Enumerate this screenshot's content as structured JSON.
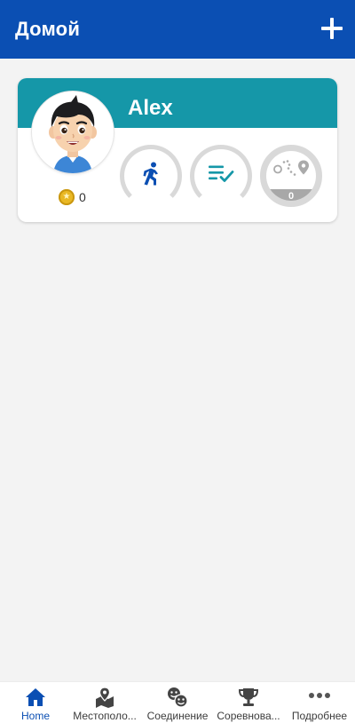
{
  "app_bar": {
    "title": "Домой",
    "add_icon": "plus-icon"
  },
  "profile_card": {
    "name": "Alex",
    "coins": "0",
    "header_color": "#1597a8",
    "status_rings": [
      {
        "id": "steps",
        "icon": "running-icon",
        "color": "#0b4fb3"
      },
      {
        "id": "tasks",
        "icon": "checklist-icon",
        "color": "#1597a8"
      },
      {
        "id": "route",
        "icon": "route-pin-icon",
        "color": "#a8a8a8",
        "count": "0"
      }
    ]
  },
  "bottom_nav": {
    "items": [
      {
        "label": "Home",
        "icon": "home-icon",
        "active": true
      },
      {
        "label": "Местополо...",
        "icon": "map-pin-icon"
      },
      {
        "label": "Соединение",
        "icon": "chat-faces-icon"
      },
      {
        "label": "Соревнова...",
        "icon": "trophy-icon"
      },
      {
        "label": "Подробнее",
        "icon": "more-dots-icon"
      }
    ]
  },
  "colors": {
    "primary": "#0b4fb3",
    "teal": "#1597a8",
    "background": "#f3f3f3",
    "ring_gray": "#d9d9d9"
  }
}
